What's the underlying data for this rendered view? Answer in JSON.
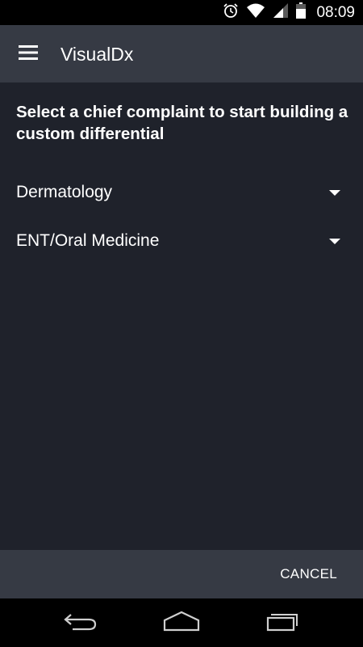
{
  "status_bar": {
    "time": "08:09",
    "icons": [
      "alarm-icon",
      "wifi-icon",
      "signal-icon",
      "battery-icon"
    ]
  },
  "app_bar": {
    "menu_icon": "hamburger-menu-icon",
    "title": "VisualDx"
  },
  "main": {
    "prompt": "Select a chief complaint to start building a custom differential",
    "complaints": [
      {
        "label": "Dermatology",
        "icon": "dropdown-arrow-icon"
      },
      {
        "label": "ENT/Oral Medicine",
        "icon": "dropdown-arrow-icon"
      }
    ]
  },
  "footer": {
    "cancel_label": "CANCEL"
  },
  "nav_bar": {
    "buttons": [
      "back-icon",
      "home-icon",
      "recent-apps-icon"
    ]
  },
  "colors": {
    "background": "#1f222b",
    "app_bar": "#363a44",
    "footer": "#363a44",
    "system_bars": "#000000",
    "text": "#ffffff"
  }
}
